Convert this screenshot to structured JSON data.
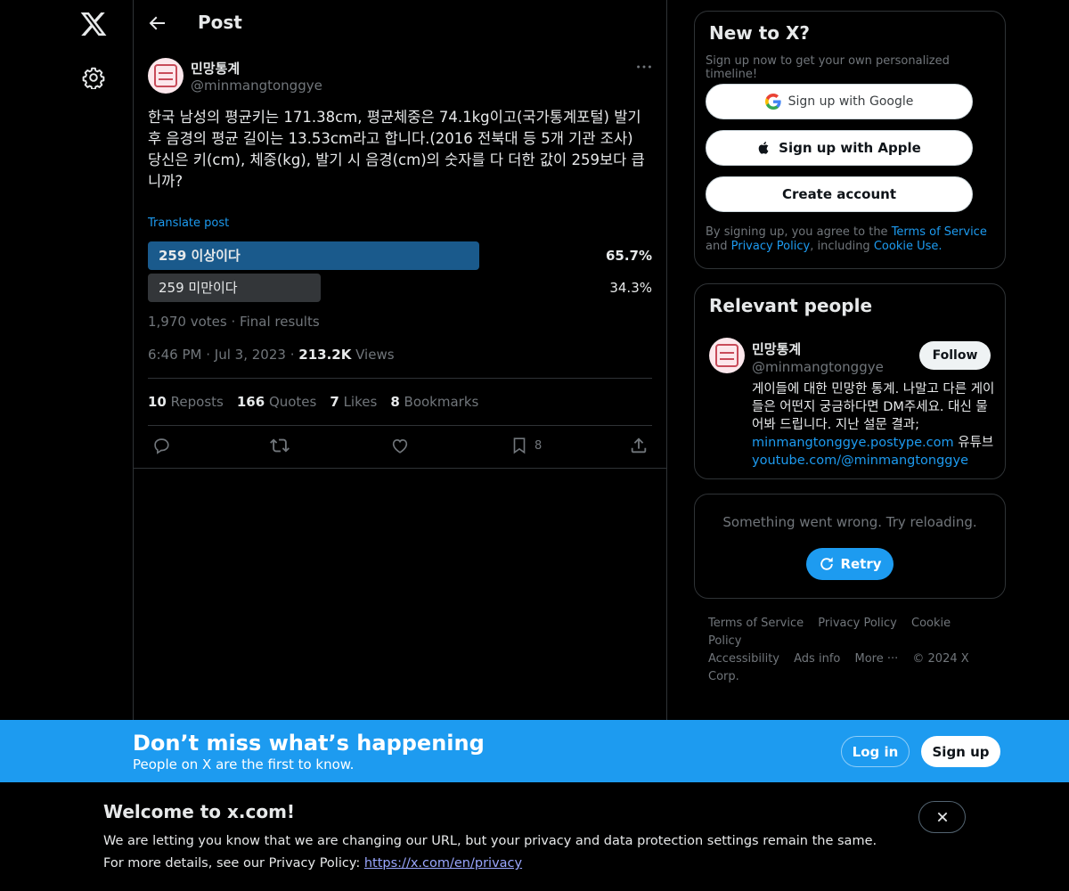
{
  "nav": {
    "logo_icon": "x-logo-icon",
    "settings_icon": "gear-icon"
  },
  "header": {
    "title": "Post",
    "back_icon": "arrow-left-icon"
  },
  "post": {
    "author_name": "민망통계",
    "author_handle": "@minmangtonggye",
    "text": "한국 남성의 평균키는 171.38cm, 평균체중은 74.1kg이고(국가통계포털) 발기 후 음경의 평균 길이는 13.53cm라고 합니다.(2016 전북대 등 5개 기관 조사)\n당신은 키(cm), 체중(kg), 발기 시 음경(cm)의 숫자를 다 더한 값이 259보다 큽니까?",
    "translate_label": "Translate post",
    "poll": {
      "options": [
        {
          "label": "259 이상이다",
          "percent_text": "65.7%",
          "percent": 65.7,
          "winner": true
        },
        {
          "label": "259 미만이다",
          "percent_text": "34.3%",
          "percent": 34.3,
          "winner": false
        }
      ],
      "votes": "1,970 votes",
      "separator": "·",
      "status": "Final results"
    },
    "time": "6:46 PM",
    "date": "Jul 3, 2023",
    "views_count": "213.2K",
    "views_label": "Views",
    "stats": {
      "reposts_count": "10",
      "reposts_label": "Reposts",
      "quotes_count": "166",
      "quotes_label": "Quotes",
      "likes_count": "7",
      "likes_label": "Likes",
      "bookmarks_count": "8",
      "bookmarks_label": "Bookmarks"
    },
    "actions": {
      "bookmark_count": "8"
    }
  },
  "signup_card": {
    "title": "New to X?",
    "subtitle": "Sign up now to get your own personalized timeline!",
    "google_label": "Sign up with Google",
    "apple_label": "Sign up with Apple",
    "create_label": "Create account",
    "legal_prefix": "By signing up, you agree to the",
    "terms_link": "Terms of Service",
    "and": "and",
    "privacy_link": "Privacy Policy",
    "including": ", including",
    "cookie_link": "Cookie Use."
  },
  "relevant_people": {
    "title": "Relevant people",
    "name": "민망통계",
    "handle": "@minmangtonggye",
    "follow_label": "Follow",
    "bio_text": "게이들에 대한 민망한 통계. 나말고 다른 게이들은 어떤지 궁금하다면 DM주세요. 대신 물어봐 드립니다. 지난 설문 결과;",
    "bio_link1": "minmangtonggye.postype.com",
    "bio_mid": "유튜브",
    "bio_link2": "youtube.com/@minmangtonggye"
  },
  "error_card": {
    "message": "Something went wrong. Try reloading.",
    "retry_label": "Retry"
  },
  "footer": {
    "links": [
      "Terms of Service",
      "Privacy Policy",
      "Cookie Policy",
      "Accessibility",
      "Ads info",
      "More ···"
    ],
    "copyright": "© 2024 X Corp."
  },
  "banner": {
    "title": "Don’t miss what’s happening",
    "subtitle": "People on X are the first to know.",
    "login_label": "Log in",
    "signup_label": "Sign up"
  },
  "notice": {
    "title": "Welcome to x.com!",
    "line1": "We are letting you know that we are changing our URL, but your privacy and data protection settings remain the same.",
    "line2_prefix": "For more details, see our Privacy Policy:",
    "link": "https://x.com/en/privacy"
  },
  "colors": {
    "accent": "#1d9bf0",
    "winner_bar": "#1a5a8c",
    "loser_bar": "#333639",
    "background": "#000000"
  }
}
